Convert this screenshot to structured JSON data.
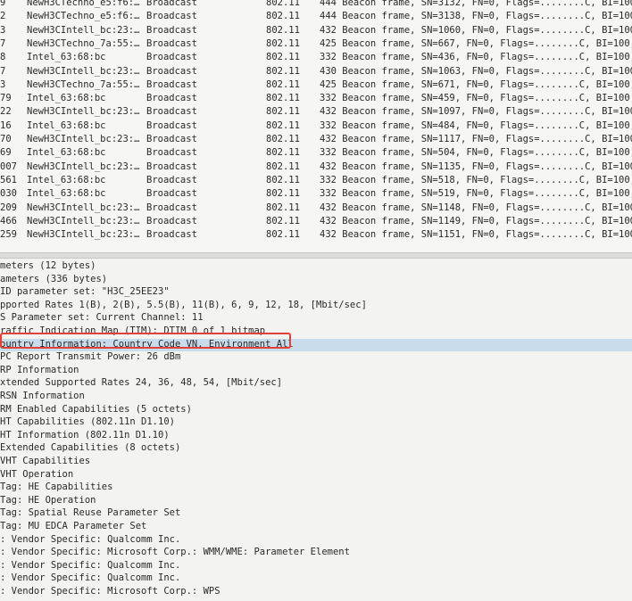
{
  "packet_list": {
    "rows": [
      {
        "no": "9",
        "src": "NewH3CTechno_e5:f6:…",
        "dst": "Broadcast",
        "proto": "802.11",
        "info": "444 Beacon frame, SN=3132, FN=0, Flags=........C, BI=100,"
      },
      {
        "no": "2",
        "src": "NewH3CTechno_e5:f6:…",
        "dst": "Broadcast",
        "proto": "802.11",
        "info": "444 Beacon frame, SN=3138, FN=0, Flags=........C, BI=100,"
      },
      {
        "no": "3",
        "src": "NewH3CIntell_bc:23:…",
        "dst": "Broadcast",
        "proto": "802.11",
        "info": "432 Beacon frame, SN=1060, FN=0, Flags=........C, BI=100,"
      },
      {
        "no": "7",
        "src": "NewH3CTechno_7a:55:…",
        "dst": "Broadcast",
        "proto": "802.11",
        "info": "425 Beacon frame, SN=667, FN=0, Flags=........C, BI=100,"
      },
      {
        "no": "8",
        "src": "Intel_63:68:bc",
        "dst": "Broadcast",
        "proto": "802.11",
        "info": "332 Beacon frame, SN=436, FN=0, Flags=........C, BI=100,"
      },
      {
        "no": "7",
        "src": "NewH3CIntell_bc:23:…",
        "dst": "Broadcast",
        "proto": "802.11",
        "info": "430 Beacon frame, SN=1063, FN=0, Flags=........C, BI=100,"
      },
      {
        "no": "3",
        "src": "NewH3CTechno_7a:55:…",
        "dst": "Broadcast",
        "proto": "802.11",
        "info": "425 Beacon frame, SN=671, FN=0, Flags=........C, BI=100,"
      },
      {
        "no": "79",
        "src": "Intel_63:68:bc",
        "dst": "Broadcast",
        "proto": "802.11",
        "info": "332 Beacon frame, SN=459, FN=0, Flags=........C, BI=100,"
      },
      {
        "no": "22",
        "src": "NewH3CIntell_bc:23:…",
        "dst": "Broadcast",
        "proto": "802.11",
        "info": "432 Beacon frame, SN=1097, FN=0, Flags=........C, BI=100,"
      },
      {
        "no": "16",
        "src": "Intel_63:68:bc",
        "dst": "Broadcast",
        "proto": "802.11",
        "info": "332 Beacon frame, SN=484, FN=0, Flags=........C, BI=100,"
      },
      {
        "no": "70",
        "src": "NewH3CIntell_bc:23:…",
        "dst": "Broadcast",
        "proto": "802.11",
        "info": "432 Beacon frame, SN=1117, FN=0, Flags=........C, BI=100,"
      },
      {
        "no": "69",
        "src": "Intel_63:68:bc",
        "dst": "Broadcast",
        "proto": "802.11",
        "info": "332 Beacon frame, SN=504, FN=0, Flags=........C, BI=100,"
      },
      {
        "no": "007",
        "src": "NewH3CIntell_bc:23:…",
        "dst": "Broadcast",
        "proto": "802.11",
        "info": "432 Beacon frame, SN=1135, FN=0, Flags=........C, BI=100,"
      },
      {
        "no": "561",
        "src": "Intel_63:68:bc",
        "dst": "Broadcast",
        "proto": "802.11",
        "info": "332 Beacon frame, SN=518, FN=0, Flags=........C, BI=100,"
      },
      {
        "no": "030",
        "src": "Intel_63:68:bc",
        "dst": "Broadcast",
        "proto": "802.11",
        "info": "332 Beacon frame, SN=519, FN=0, Flags=........C, BI=100,"
      },
      {
        "no": "209",
        "src": "NewH3CIntell_bc:23:…",
        "dst": "Broadcast",
        "proto": "802.11",
        "info": "432 Beacon frame, SN=1148, FN=0, Flags=........C, BI=100,"
      },
      {
        "no": "466",
        "src": "NewH3CIntell_bc:23:…",
        "dst": "Broadcast",
        "proto": "802.11",
        "info": "432 Beacon frame, SN=1149, FN=0, Flags=........C, BI=100,"
      },
      {
        "no": "259",
        "src": "NewH3CIntell_bc:23:…",
        "dst": "Broadcast",
        "proto": "802.11",
        "info": "432 Beacon frame, SN=1151, FN=0, Flags=........C, BI=100,"
      }
    ]
  },
  "details": {
    "lines": [
      "meters (12 bytes)",
      "ameters (336 bytes)",
      "ID parameter set: \"H3C_25EE23\"",
      "pported Rates 1(B), 2(B), 5.5(B), 11(B), 6, 9, 12, 18, [Mbit/sec]",
      "S Parameter set: Current Channel: 11",
      "raffic Indication Map (TIM): DTIM 0 of 1 bitmap",
      "ountry Information: Country Code VN, Environment All",
      "PC Report Transmit Power: 26 dBm",
      "RP Information",
      "xtended Supported Rates 24, 36, 48, 54, [Mbit/sec]",
      "RSN Information",
      "RM Enabled Capabilities (5 octets)",
      "HT Capabilities (802.11n D1.10)",
      "HT Information (802.11n D1.10)",
      "Extended Capabilities (8 octets)",
      "VHT Capabilities",
      "VHT Operation",
      "Tag: HE Capabilities",
      "Tag: HE Operation",
      "Tag: Spatial Reuse Parameter Set",
      "Tag: MU EDCA Parameter Set",
      ": Vendor Specific: Qualcomm Inc.",
      ": Vendor Specific: Microsoft Corp.: WMM/WME: Parameter Element",
      ": Vendor Specific: Qualcomm Inc.",
      ": Vendor Specific: Qualcomm Inc.",
      ": Vendor Specific: Microsoft Corp.: WPS"
    ],
    "selected_index": 6
  },
  "colors": {
    "selected_bg": "#c9dcec",
    "highlight_border": "#e0413a"
  }
}
